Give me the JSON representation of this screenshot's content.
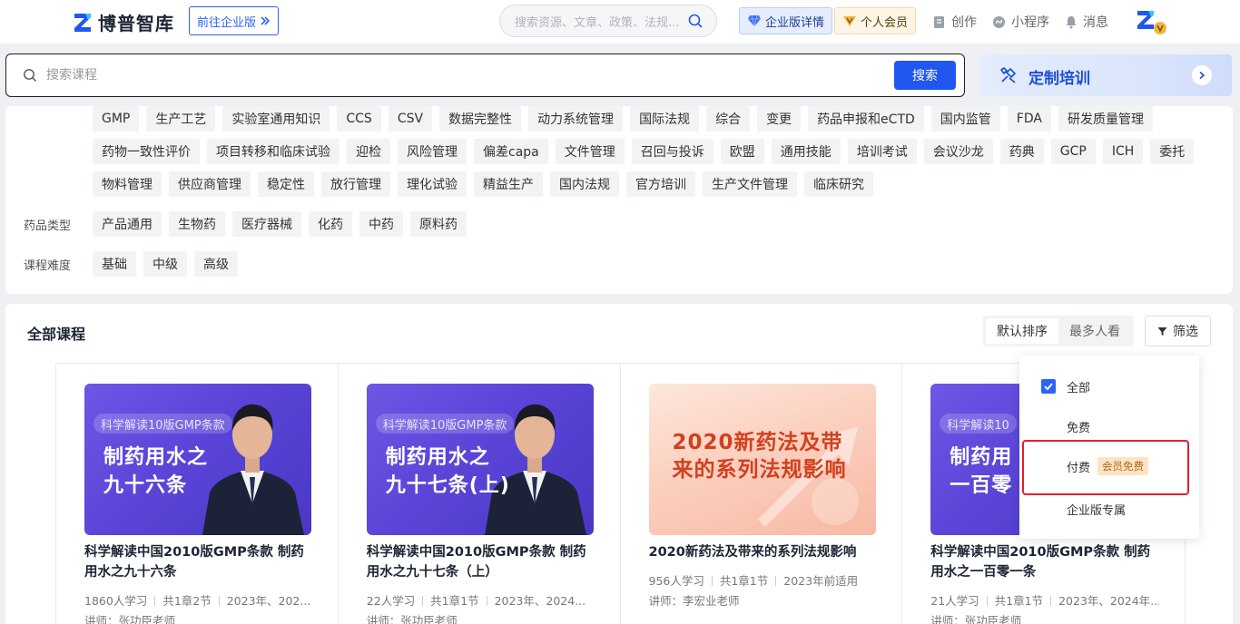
{
  "header": {
    "brand": "博普智库",
    "enterprise_link": "前往企业版",
    "search_placeholder": "搜索资源、文章、政策、法规...",
    "enterprise_detail": "企业版详情",
    "personal_member": "个人会员",
    "nav": [
      "创作",
      "小程序",
      "消息"
    ]
  },
  "course_search": {
    "placeholder": "搜索课程",
    "button": "搜索",
    "training_label": "定制培训"
  },
  "filters": {
    "topic_tags_row1": [
      "GMP",
      "生产工艺",
      "实验室通用知识",
      "CCS",
      "CSV",
      "数据完整性",
      "动力系统管理",
      "国际法规",
      "综合",
      "变更",
      "药品申报和eCTD",
      "国内监管",
      "FDA",
      "研发质量管理"
    ],
    "topic_tags_row2": [
      "药物一致性评价",
      "项目转移和临床试验",
      "迎检",
      "风险管理",
      "偏差capa",
      "文件管理",
      "召回与投诉",
      "欧盟",
      "通用技能",
      "培训考试",
      "会议沙龙",
      "药典",
      "GCP",
      "ICH",
      "委托"
    ],
    "topic_tags_row3": [
      "物料管理",
      "供应商管理",
      "稳定性",
      "放行管理",
      "理化试验",
      "精益生产",
      "国内法规",
      "官方培训",
      "生产文件管理",
      "临床研究"
    ],
    "drug_type_label": "药品类型",
    "drug_types": [
      "产品通用",
      "生物药",
      "医疗器械",
      "化药",
      "中药",
      "原料药"
    ],
    "difficulty_label": "课程难度",
    "difficulties": [
      "基础",
      "中级",
      "高级"
    ]
  },
  "courses_section": {
    "title": "全部课程",
    "sort_default": "默认排序",
    "sort_popular": "最多人看",
    "filter_button": "筛选"
  },
  "courses": [
    {
      "thumb_badge": "科学解读10版GMP条款",
      "thumb_title_line1": "制药用水之",
      "thumb_title_line2": "九十六条",
      "title": "科学解读中国2010版GMP条款 制药用水之九十六条",
      "learners": "1860人学习",
      "chapters": "共1章2节",
      "applicable": "2023年、202...",
      "lecturer": "讲师：张功臣老师"
    },
    {
      "thumb_badge": "科学解读10版GMP条款",
      "thumb_title_line1": "制药用水之",
      "thumb_title_line2": "九十七条(上)",
      "title": "科学解读中国2010版GMP条款 制药用水之九十七条（上）",
      "learners": "22人学习",
      "chapters": "共1章1节",
      "applicable": "2023年、2024...",
      "lecturer": "讲师：张功臣老师"
    },
    {
      "thumb_title_line1": "2020新药法及带",
      "thumb_title_line2": "来的系列法规影响",
      "title": "2020新药法及带来的系列法规影响",
      "learners": "956人学习",
      "chapters": "共1章1节",
      "applicable": "2023年前适用",
      "lecturer": "讲师：李宏业老师"
    },
    {
      "thumb_badge": "科学解读10",
      "thumb_title_line1": "制药用",
      "thumb_title_line2": "一百零",
      "title": "科学解读中国2010版GMP条款 制药用水之一百零一条",
      "learners": "21人学习",
      "chapters": "共1章1节",
      "applicable": "2023年、2024年...",
      "lecturer": "讲师：张功臣老师"
    }
  ],
  "filter_dropdown": {
    "all": "全部",
    "free": "免费",
    "paid": "付费",
    "member_free": "会员免费",
    "enterprise_only": "企业版专属"
  },
  "colors": {
    "primary": "#1f57f0",
    "highlight": "#e0202a",
    "thumb_purple": "#5a45d8",
    "thumb_peach": "#fbd0bf"
  }
}
